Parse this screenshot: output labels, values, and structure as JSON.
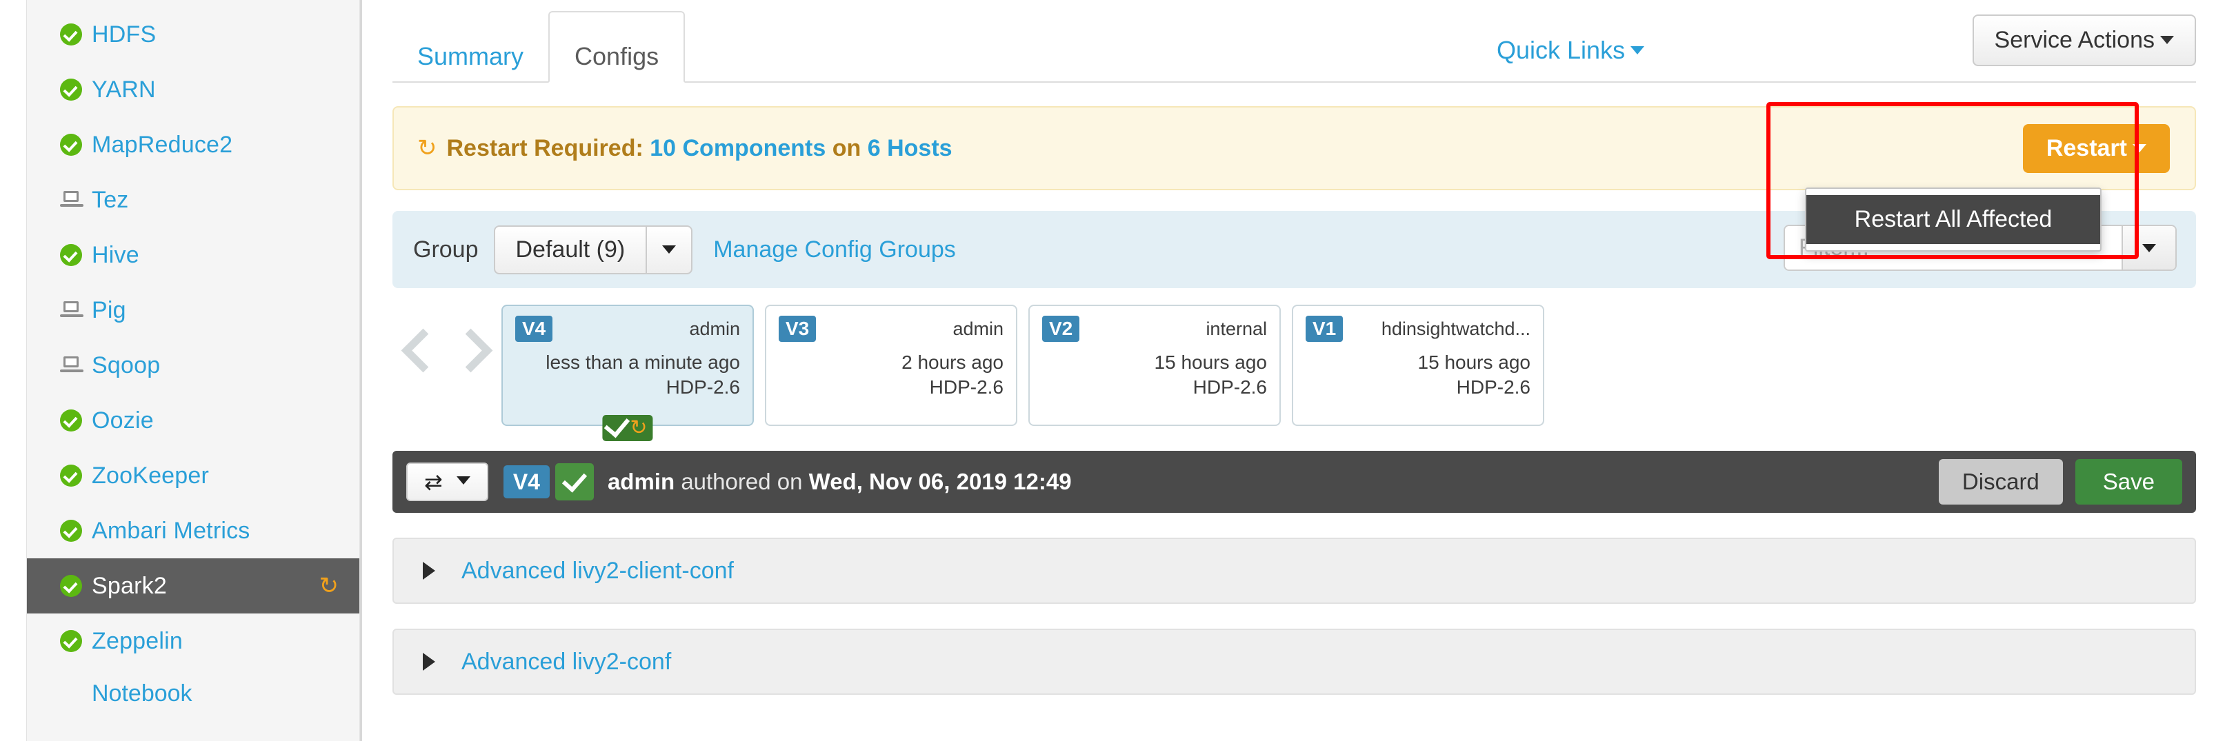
{
  "sidebar": {
    "items": [
      {
        "label": "HDFS",
        "icon": "ok-circle-icon",
        "active": false,
        "trailing": null
      },
      {
        "label": "YARN",
        "icon": "ok-circle-icon",
        "active": false,
        "trailing": null
      },
      {
        "label": "MapReduce2",
        "icon": "ok-circle-icon",
        "active": false,
        "trailing": null
      },
      {
        "label": "Tez",
        "icon": "client-laptop-icon",
        "active": false,
        "trailing": null
      },
      {
        "label": "Hive",
        "icon": "ok-circle-icon",
        "active": false,
        "trailing": null
      },
      {
        "label": "Pig",
        "icon": "client-laptop-icon",
        "active": false,
        "trailing": null
      },
      {
        "label": "Sqoop",
        "icon": "client-laptop-icon",
        "active": false,
        "trailing": null
      },
      {
        "label": "Oozie",
        "icon": "ok-circle-icon",
        "active": false,
        "trailing": null
      },
      {
        "label": "ZooKeeper",
        "icon": "ok-circle-icon",
        "active": false,
        "trailing": null
      },
      {
        "label": "Ambari Metrics",
        "icon": "ok-circle-icon",
        "active": false,
        "trailing": null
      },
      {
        "label": "Spark2",
        "icon": "ok-circle-icon",
        "active": true,
        "trailing": "restart-required-icon"
      },
      {
        "label": "Zeppelin Notebook",
        "icon": "ok-circle-icon",
        "active": false,
        "trailing": null
      }
    ]
  },
  "tabs": {
    "summary": "Summary",
    "configs": "Configs",
    "quick_links": "Quick Links",
    "service_actions": "Service Actions"
  },
  "alert": {
    "prefix": "Restart Required:",
    "components": "10 Components",
    "middle": "on",
    "hosts": "6 Hosts",
    "restart_button": "Restart",
    "menu_items": [
      "Restart All Affected"
    ]
  },
  "group_bar": {
    "group_label": "Group",
    "selected_group": "Default (9)",
    "manage_link": "Manage Config Groups",
    "filter_placeholder": "Filter...",
    "filter_value": ""
  },
  "versions": [
    {
      "version": "V4",
      "author": "admin",
      "when": "less than a minute ago",
      "stack": "HDP-2.6",
      "current": true,
      "flag": true
    },
    {
      "version": "V3",
      "author": "admin",
      "when": "2 hours ago",
      "stack": "HDP-2.6",
      "current": false,
      "flag": false
    },
    {
      "version": "V2",
      "author": "internal",
      "when": "15 hours ago",
      "stack": "HDP-2.6",
      "current": false,
      "flag": false
    },
    {
      "version": "V1",
      "author": "hdinsightwatchd...",
      "when": "15 hours ago",
      "stack": "HDP-2.6",
      "current": false,
      "flag": false
    }
  ],
  "version_bar": {
    "version": "V4",
    "author": "admin",
    "authored_text": "authored on",
    "timestamp": "Wed, Nov 06, 2019 12:49",
    "discard": "Discard",
    "save": "Save"
  },
  "accordions": [
    {
      "title": "Advanced livy2-client-conf"
    },
    {
      "title": "Advanced livy2-conf"
    }
  ],
  "colors": {
    "accent_blue": "#2a9fd8",
    "warning_orange": "#f0a11c",
    "ok_green": "#5cb811",
    "save_green": "#3e8b3e",
    "highlight_red": "#ff0000",
    "dark_bar": "#4a4a4a"
  }
}
